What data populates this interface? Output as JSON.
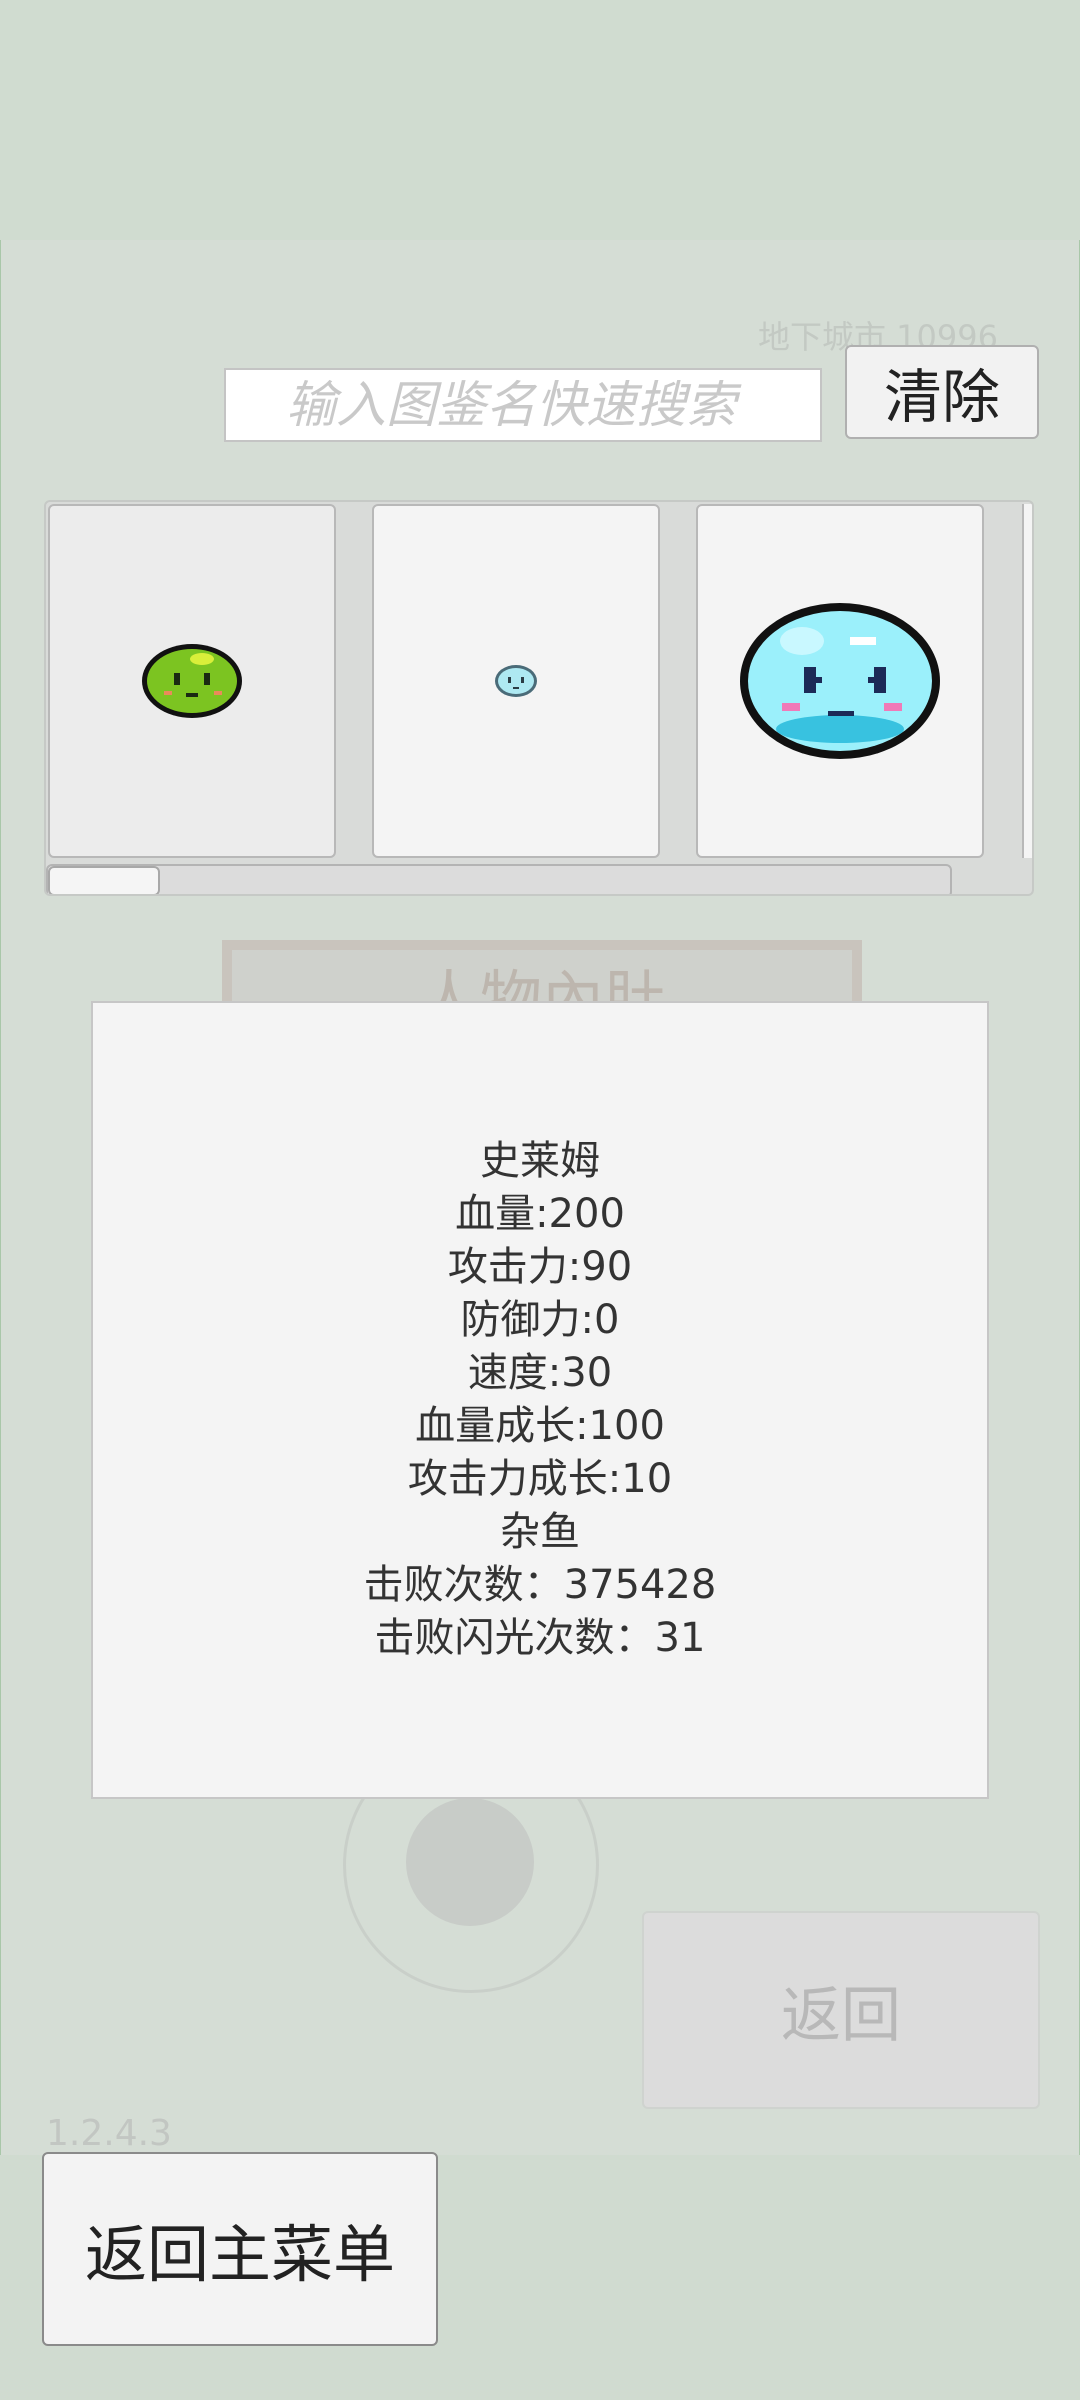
{
  "background": {
    "faded_label": "地下城市 10996",
    "faded_heading": "人物內肚",
    "faded_return_label": "返回",
    "version": "1.2.4.3"
  },
  "search": {
    "placeholder": "输入图鉴名快速搜索",
    "value": "",
    "clear_label": "清除"
  },
  "carousel": {
    "cards": [
      {
        "name": "green-slime",
        "body_color": "#7cc421",
        "selected": true
      },
      {
        "name": "tiny-blue-slime",
        "body_color": "#aee9f2",
        "selected": false
      },
      {
        "name": "big-blue-slime",
        "body_color": "#9bf0fb",
        "selected": false
      }
    ],
    "scroll_position": 0.0
  },
  "info": {
    "lines": [
      "史莱姆",
      "血量:200",
      "攻击力:90",
      "防御力:0",
      "速度:30",
      "血量成长:100",
      "攻击力成长:10",
      "杂鱼",
      "击败次数：375428",
      "击败闪光次数：31"
    ]
  },
  "main_menu_label": "返回主菜单",
  "colors": {
    "background": "#d5ddd5",
    "panel": "#f4f4f4",
    "border": "#b8b8b8"
  }
}
